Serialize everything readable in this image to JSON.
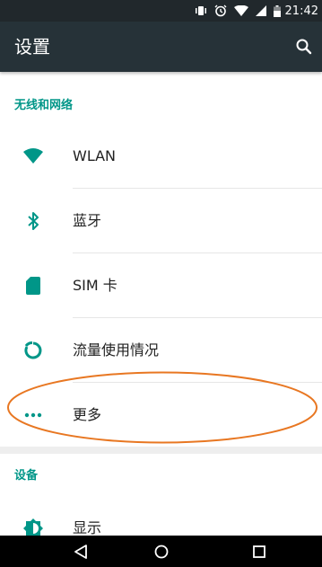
{
  "status_bar": {
    "time": "21:42",
    "icons": [
      "vibrate-icon",
      "alarm-icon",
      "wifi-icon",
      "cellular-icon",
      "battery-icon"
    ]
  },
  "app_bar": {
    "title": "设置",
    "search_icon": "search-icon"
  },
  "sections": [
    {
      "header": "无线和网络",
      "items": [
        {
          "label": "WLAN",
          "icon": "wifi-icon"
        },
        {
          "label": "蓝牙",
          "icon": "bluetooth-icon"
        },
        {
          "label": "SIM 卡",
          "icon": "sim-card-icon"
        },
        {
          "label": "流量使用情况",
          "icon": "data-usage-icon"
        },
        {
          "label": "更多",
          "icon": "more-horiz-icon"
        }
      ]
    },
    {
      "header": "设备",
      "items": [
        {
          "label": "显示",
          "icon": "brightness-icon"
        }
      ]
    }
  ],
  "annotation": {
    "color": "#e87722"
  },
  "nav_bar": {
    "buttons": [
      "back-icon",
      "home-icon",
      "recents-icon"
    ]
  },
  "colors": {
    "accent": "#009688",
    "app_bar": "#263238",
    "status_bar": "#21282c"
  }
}
